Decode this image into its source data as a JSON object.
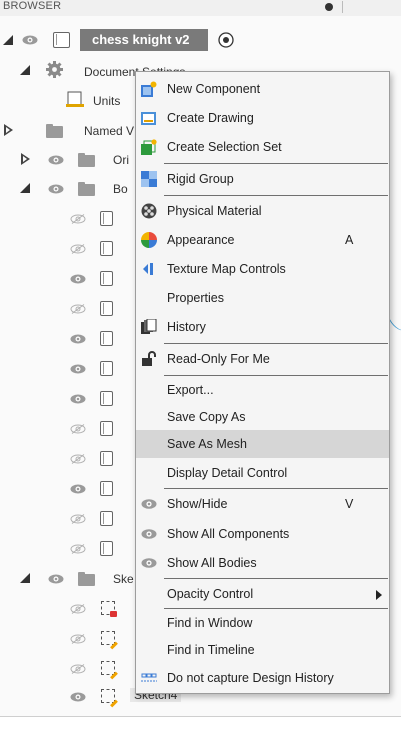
{
  "header": {
    "title": "BROWSER"
  },
  "tree": {
    "root": {
      "label": "chess knight v2"
    },
    "document_settings": "Document Settings",
    "units": "Units",
    "named_views": "Named V",
    "origin": "Ori",
    "bodies": "Bo",
    "sketches": "Ske",
    "sketch4": "Sketch4"
  },
  "menu": {
    "items": [
      {
        "label": "New Component",
        "icon": "new-component-icon"
      },
      {
        "label": "Create Drawing",
        "icon": "create-drawing-icon"
      },
      {
        "label": "Create Selection Set",
        "icon": "selection-set-icon"
      },
      {
        "label": "Rigid Group",
        "icon": "rigid-group-icon"
      },
      {
        "label": "Physical Material",
        "icon": "physical-material-icon"
      },
      {
        "label": "Appearance",
        "icon": "appearance-icon",
        "shortcut": "A"
      },
      {
        "label": "Texture Map Controls",
        "icon": "texture-map-icon"
      },
      {
        "label": "Properties"
      },
      {
        "label": "History",
        "icon": "history-icon"
      },
      {
        "label": "Read-Only For Me",
        "icon": "unlock-icon"
      },
      {
        "label": "Export..."
      },
      {
        "label": "Save Copy As"
      },
      {
        "label": "Save As Mesh",
        "highlighted": true
      },
      {
        "label": "Display Detail Control"
      },
      {
        "label": "Show/Hide",
        "icon": "eye-icon",
        "shortcut": "V"
      },
      {
        "label": "Show All Components",
        "icon": "eye-icon"
      },
      {
        "label": "Show All Bodies",
        "icon": "eye-icon"
      },
      {
        "label": "Opacity Control",
        "submenu": true
      },
      {
        "label": "Find in Window"
      },
      {
        "label": "Find in Timeline"
      },
      {
        "label": "Do not capture Design History",
        "icon": "capture-history-icon"
      }
    ]
  },
  "colors": {
    "highlight": "#d6d6d6",
    "root_label_bg": "#7a7a7a",
    "folder": "#9a9a9a",
    "sketch_pencil": "#f0a300"
  }
}
